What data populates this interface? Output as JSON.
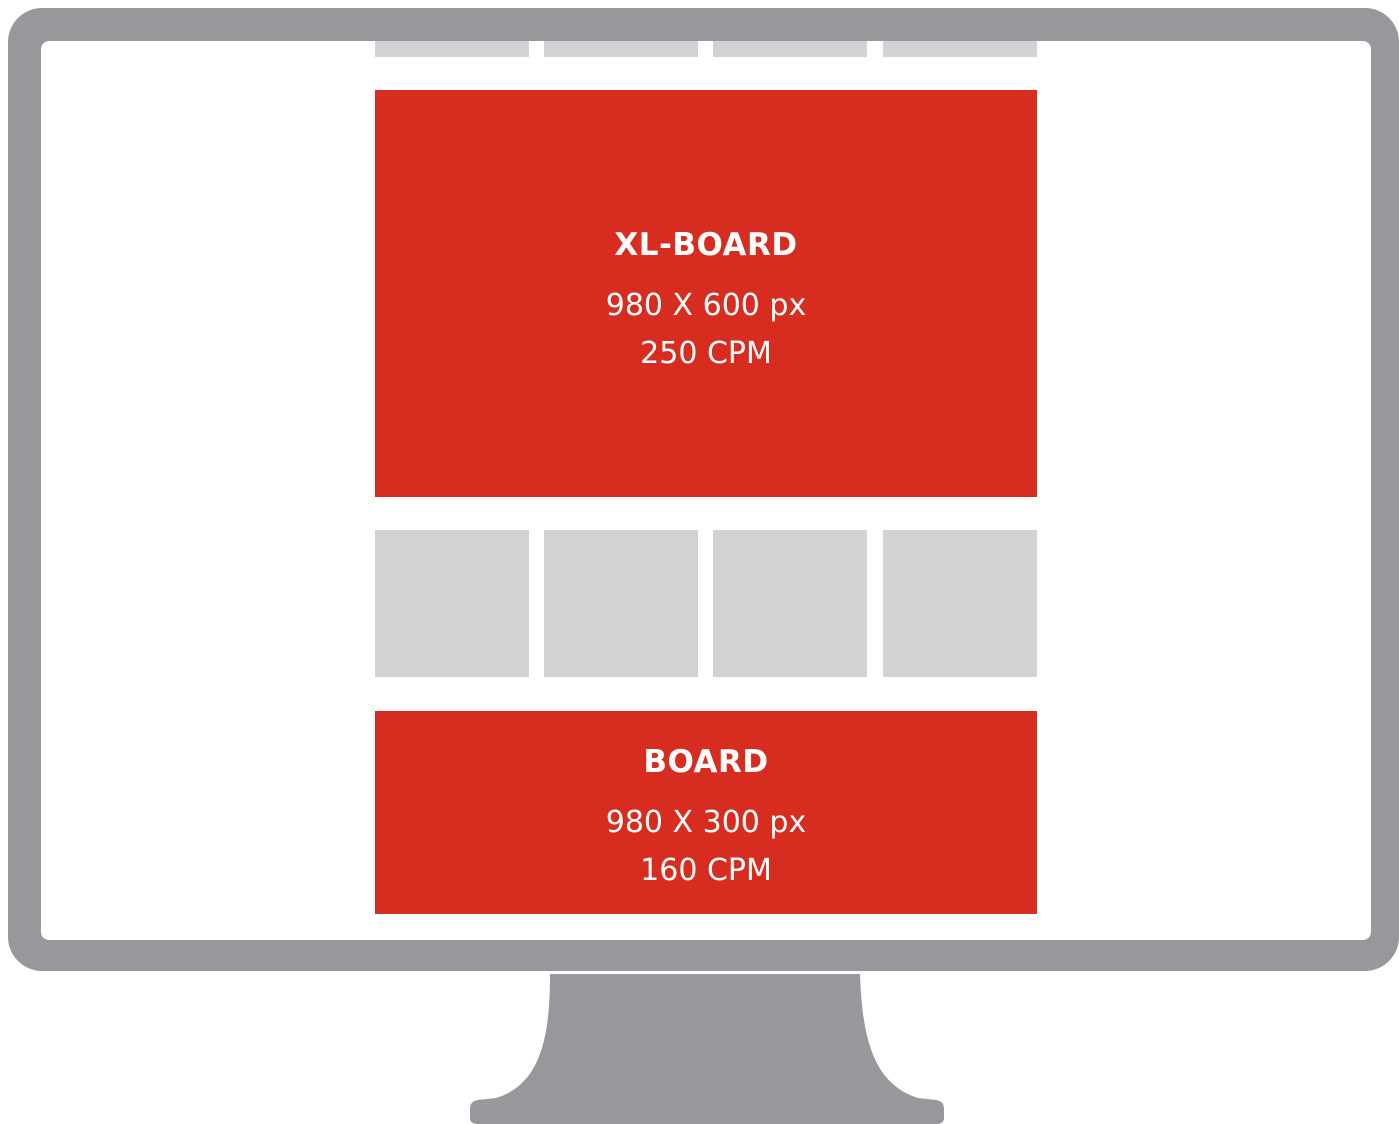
{
  "colors": {
    "frame": "#97989b",
    "screen": "#ffffff",
    "tile": "#d1d2d4",
    "ad": "#d72c20",
    "ad_text": "#ffffff"
  },
  "ads": {
    "xl_board": {
      "title": "XL-BOARD",
      "size": "980 X 600 px",
      "price": "250 CPM"
    },
    "board": {
      "title": "BOARD",
      "size": "980 X 300 px",
      "price": "160 CPM"
    }
  }
}
